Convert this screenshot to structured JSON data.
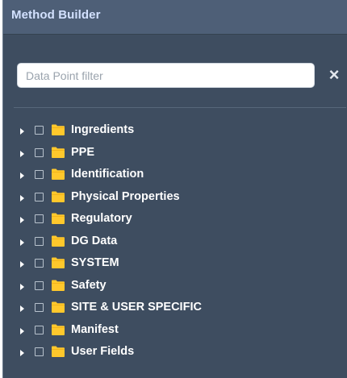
{
  "panel": {
    "title": "Method Builder"
  },
  "filter": {
    "placeholder": "Data Point filter",
    "value": "",
    "clear_icon": "×"
  },
  "tree": {
    "items": [
      {
        "label": "Ingredients",
        "icon": "folder-icon"
      },
      {
        "label": "PPE",
        "icon": "folder-icon"
      },
      {
        "label": "Identification",
        "icon": "folder-icon"
      },
      {
        "label": "Physical Properties",
        "icon": "folder-icon"
      },
      {
        "label": "Regulatory",
        "icon": "folder-icon"
      },
      {
        "label": "DG Data",
        "icon": "folder-icon"
      },
      {
        "label": "SYSTEM",
        "icon": "folder-icon"
      },
      {
        "label": "Safety",
        "icon": "folder-icon"
      },
      {
        "label": "SITE & USER SPECIFIC",
        "icon": "folder-icon"
      },
      {
        "label": "Manifest",
        "icon": "folder-icon"
      },
      {
        "label": "User Fields",
        "icon": "folder-icon"
      }
    ]
  },
  "colors": {
    "panel_bg": "#3e4d60",
    "header_bg": "#4e5f77",
    "title_text": "#d3e1ff",
    "folder": "#ffc82c",
    "label_text": "#ffffff"
  }
}
